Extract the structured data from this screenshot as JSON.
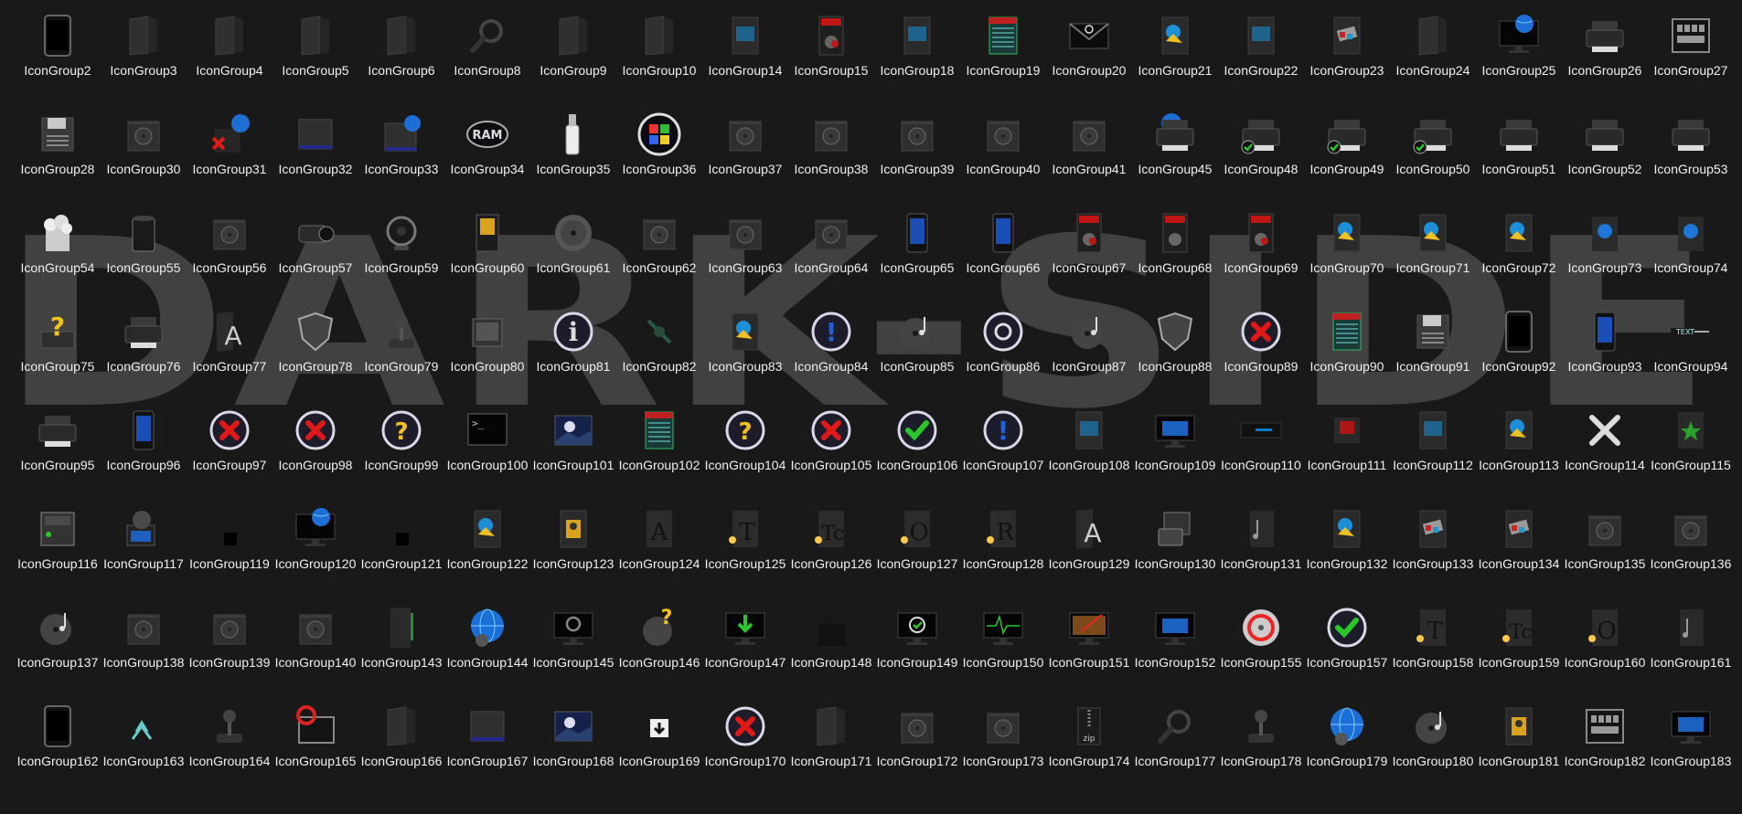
{
  "watermark": "DARK-SIDE v2",
  "colors": {
    "background": "#191919",
    "label": "#f0f0f0",
    "error_red": "#e01818",
    "ok_green": "#28c828",
    "help_yellow": "#f3c21a",
    "info_blue": "#1e60e0"
  },
  "icons": [
    {
      "label": "IconGroup2",
      "icon": "phone"
    },
    {
      "label": "IconGroup3",
      "icon": "folder"
    },
    {
      "label": "IconGroup4",
      "icon": "folder"
    },
    {
      "label": "IconGroup5",
      "icon": "folder"
    },
    {
      "label": "IconGroup6",
      "icon": "folder"
    },
    {
      "label": "IconGroup8",
      "icon": "search"
    },
    {
      "label": "IconGroup9",
      "icon": "folder"
    },
    {
      "label": "IconGroup10",
      "icon": "folder"
    },
    {
      "label": "IconGroup14",
      "icon": "document"
    },
    {
      "label": "IconGroup15",
      "icon": "exe"
    },
    {
      "label": "IconGroup18",
      "icon": "document"
    },
    {
      "label": "IconGroup19",
      "icon": "text"
    },
    {
      "label": "IconGroup20",
      "icon": "mail"
    },
    {
      "label": "IconGroup21",
      "icon": "pictures"
    },
    {
      "label": "IconGroup22",
      "icon": "document"
    },
    {
      "label": "IconGroup23",
      "icon": "movies"
    },
    {
      "label": "IconGroup24",
      "icon": "folder"
    },
    {
      "label": "IconGroup25",
      "icon": "monitor-globe"
    },
    {
      "label": "IconGroup26",
      "icon": "printer"
    },
    {
      "label": "IconGroup27",
      "icon": "keyboard"
    },
    {
      "label": "IconGroup28",
      "icon": "floppy"
    },
    {
      "label": "IconGroup30",
      "icon": "disc-drive"
    },
    {
      "label": "IconGroup31",
      "icon": "network-x"
    },
    {
      "label": "IconGroup32",
      "icon": "hdd"
    },
    {
      "label": "IconGroup33",
      "icon": "hdd-globe"
    },
    {
      "label": "IconGroup34",
      "icon": "ram"
    },
    {
      "label": "IconGroup35",
      "icon": "usb"
    },
    {
      "label": "IconGroup36",
      "icon": "windows"
    },
    {
      "label": "IconGroup37",
      "icon": "disc-drive"
    },
    {
      "label": "IconGroup38",
      "icon": "disc-drive"
    },
    {
      "label": "IconGroup39",
      "icon": "disc-drive"
    },
    {
      "label": "IconGroup40",
      "icon": "disc-drive"
    },
    {
      "label": "IconGroup41",
      "icon": "disc-drive"
    },
    {
      "label": "IconGroup45",
      "icon": "printer-globe"
    },
    {
      "label": "IconGroup48",
      "icon": "printer-check"
    },
    {
      "label": "IconGroup49",
      "icon": "printer-check"
    },
    {
      "label": "IconGroup50",
      "icon": "printer-check"
    },
    {
      "label": "IconGroup51",
      "icon": "printer"
    },
    {
      "label": "IconGroup52",
      "icon": "printer"
    },
    {
      "label": "IconGroup53",
      "icon": "printer"
    },
    {
      "label": "IconGroup54",
      "icon": "trash-full"
    },
    {
      "label": "IconGroup55",
      "icon": "trash"
    },
    {
      "label": "IconGroup56",
      "icon": "disc-drive"
    },
    {
      "label": "IconGroup57",
      "icon": "camcorder"
    },
    {
      "label": "IconGroup59",
      "icon": "webcam"
    },
    {
      "label": "IconGroup60",
      "icon": "sdcard"
    },
    {
      "label": "IconGroup61",
      "icon": "disc"
    },
    {
      "label": "IconGroup62",
      "icon": "disc-drive"
    },
    {
      "label": "IconGroup63",
      "icon": "disc-drive"
    },
    {
      "label": "IconGroup64",
      "icon": "disc-drive"
    },
    {
      "label": "IconGroup65",
      "icon": "phone-blue"
    },
    {
      "label": "IconGroup66",
      "icon": "phone-blue"
    },
    {
      "label": "IconGroup67",
      "icon": "exe"
    },
    {
      "label": "IconGroup68",
      "icon": "batch"
    },
    {
      "label": "IconGroup69",
      "icon": "exe"
    },
    {
      "label": "IconGroup70",
      "icon": "pictures"
    },
    {
      "label": "IconGroup71",
      "icon": "pictures"
    },
    {
      "label": "IconGroup72",
      "icon": "pictures"
    },
    {
      "label": "IconGroup73",
      "icon": "panel-globe"
    },
    {
      "label": "IconGroup74",
      "icon": "panel-globe"
    },
    {
      "label": "IconGroup75",
      "icon": "help-box"
    },
    {
      "label": "IconGroup76",
      "icon": "printer"
    },
    {
      "label": "IconGroup77",
      "icon": "font"
    },
    {
      "label": "IconGroup78",
      "icon": "shield"
    },
    {
      "label": "IconGroup79",
      "icon": "joystick"
    },
    {
      "label": "IconGroup80",
      "icon": "scanner"
    },
    {
      "label": "IconGroup81",
      "icon": "info"
    },
    {
      "label": "IconGroup82",
      "icon": "satellite"
    },
    {
      "label": "IconGroup83",
      "icon": "pictures"
    },
    {
      "label": "IconGroup84",
      "icon": "warning"
    },
    {
      "label": "IconGroup85",
      "icon": "music"
    },
    {
      "label": "IconGroup86",
      "icon": "biohazard"
    },
    {
      "label": "IconGroup87",
      "icon": "music"
    },
    {
      "label": "IconGroup88",
      "icon": "shield"
    },
    {
      "label": "IconGroup89",
      "icon": "error"
    },
    {
      "label": "IconGroup90",
      "icon": "text"
    },
    {
      "label": "IconGroup91",
      "icon": "floppy"
    },
    {
      "label": "IconGroup92",
      "icon": "phone"
    },
    {
      "label": "IconGroup93",
      "icon": "phone-blue"
    },
    {
      "label": "IconGroup94",
      "icon": "text-arrow"
    },
    {
      "label": "IconGroup95",
      "icon": "printer"
    },
    {
      "label": "IconGroup96",
      "icon": "phone-blue"
    },
    {
      "label": "IconGroup97",
      "icon": "error"
    },
    {
      "label": "IconGroup98",
      "icon": "error"
    },
    {
      "label": "IconGroup99",
      "icon": "help"
    },
    {
      "label": "IconGroup100",
      "icon": "terminal"
    },
    {
      "label": "IconGroup101",
      "icon": "image"
    },
    {
      "label": "IconGroup102",
      "icon": "text"
    },
    {
      "label": "IconGroup104",
      "icon": "help"
    },
    {
      "label": "IconGroup105",
      "icon": "error"
    },
    {
      "label": "IconGroup106",
      "icon": "ok"
    },
    {
      "label": "IconGroup107",
      "icon": "warning"
    },
    {
      "label": "IconGroup108",
      "icon": "document"
    },
    {
      "label": "IconGroup109",
      "icon": "monitor"
    },
    {
      "label": "IconGroup110",
      "icon": "taskbar"
    },
    {
      "label": "IconGroup111",
      "icon": "network"
    },
    {
      "label": "IconGroup112",
      "icon": "document"
    },
    {
      "label": "IconGroup113",
      "icon": "pictures"
    },
    {
      "label": "IconGroup114",
      "icon": "tools"
    },
    {
      "label": "IconGroup115",
      "icon": "favorites"
    },
    {
      "label": "IconGroup116",
      "icon": "control-panel"
    },
    {
      "label": "IconGroup117",
      "icon": "network-globe"
    },
    {
      "label": "IconGroup119",
      "icon": "black-square"
    },
    {
      "label": "IconGroup120",
      "icon": "monitor-globe"
    },
    {
      "label": "IconGroup121",
      "icon": "black-square"
    },
    {
      "label": "IconGroup122",
      "icon": "pictures"
    },
    {
      "label": "IconGroup123",
      "icon": "contacts"
    },
    {
      "label": "IconGroup124",
      "icon": "font-a"
    },
    {
      "label": "IconGroup125",
      "icon": "font-t"
    },
    {
      "label": "IconGroup126",
      "icon": "font-tc"
    },
    {
      "label": "IconGroup127",
      "icon": "font-o"
    },
    {
      "label": "IconGroup128",
      "icon": "font-r"
    },
    {
      "label": "IconGroup129",
      "icon": "font"
    },
    {
      "label": "IconGroup130",
      "icon": "briefcase"
    },
    {
      "label": "IconGroup131",
      "icon": "music-doc"
    },
    {
      "label": "IconGroup132",
      "icon": "pictures"
    },
    {
      "label": "IconGroup133",
      "icon": "movies"
    },
    {
      "label": "IconGroup134",
      "icon": "movies"
    },
    {
      "label": "IconGroup135",
      "icon": "disc-drive"
    },
    {
      "label": "IconGroup136",
      "icon": "disc-drive"
    },
    {
      "label": "IconGroup137",
      "icon": "music"
    },
    {
      "label": "IconGroup138",
      "icon": "disc-drive"
    },
    {
      "label": "IconGroup139",
      "icon": "disc-drive"
    },
    {
      "label": "IconGroup140",
      "icon": "disc-drive"
    },
    {
      "label": "IconGroup143",
      "icon": "panel"
    },
    {
      "label": "IconGroup144",
      "icon": "globe"
    },
    {
      "label": "IconGroup145",
      "icon": "monitor-search"
    },
    {
      "label": "IconGroup146",
      "icon": "help-disc"
    },
    {
      "label": "IconGroup147",
      "icon": "monitor-download"
    },
    {
      "label": "IconGroup148",
      "icon": "blocks"
    },
    {
      "label": "IconGroup149",
      "icon": "monitor-check"
    },
    {
      "label": "IconGroup150",
      "icon": "monitor-pulse"
    },
    {
      "label": "IconGroup151",
      "icon": "monitor-paint"
    },
    {
      "label": "IconGroup152",
      "icon": "monitor"
    },
    {
      "label": "IconGroup155",
      "icon": "cd-red"
    },
    {
      "label": "IconGroup157",
      "icon": "ok"
    },
    {
      "label": "IconGroup158",
      "icon": "font-t"
    },
    {
      "label": "IconGroup159",
      "icon": "font-tc"
    },
    {
      "label": "IconGroup160",
      "icon": "font-o"
    },
    {
      "label": "IconGroup161",
      "icon": "music-doc"
    },
    {
      "label": "IconGroup162",
      "icon": "phone"
    },
    {
      "label": "IconGroup163",
      "icon": "arrows"
    },
    {
      "label": "IconGroup164",
      "icon": "joystick"
    },
    {
      "label": "IconGroup165",
      "icon": "keyboard-red"
    },
    {
      "label": "IconGroup166",
      "icon": "folder"
    },
    {
      "label": "IconGroup167",
      "icon": "hdd"
    },
    {
      "label": "IconGroup168",
      "icon": "image"
    },
    {
      "label": "IconGroup169",
      "icon": "download"
    },
    {
      "label": "IconGroup170",
      "icon": "error"
    },
    {
      "label": "IconGroup171",
      "icon": "folder"
    },
    {
      "label": "IconGroup172",
      "icon": "disc-drive"
    },
    {
      "label": "IconGroup173",
      "icon": "disc-drive"
    },
    {
      "label": "IconGroup174",
      "icon": "zip"
    },
    {
      "label": "IconGroup177",
      "icon": "search"
    },
    {
      "label": "IconGroup178",
      "icon": "joystick"
    },
    {
      "label": "IconGroup179",
      "icon": "globe"
    },
    {
      "label": "IconGroup180",
      "icon": "music"
    },
    {
      "label": "IconGroup181",
      "icon": "contacts"
    },
    {
      "label": "IconGroup182",
      "icon": "keyboard"
    },
    {
      "label": "IconGroup183",
      "icon": "monitor"
    }
  ]
}
